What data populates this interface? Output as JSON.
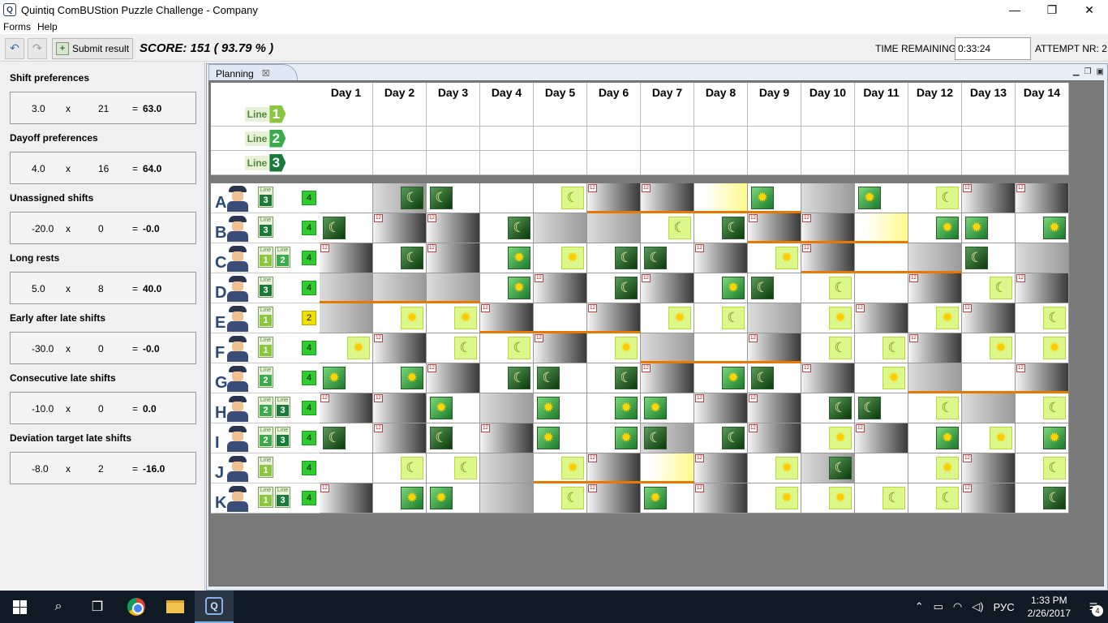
{
  "window": {
    "title": "Quintiq ComBUStion Puzzle Challenge - Company",
    "app_icon_glyph": "Q",
    "controls": [
      "—",
      "❐",
      "✕"
    ]
  },
  "menu": [
    "Forms",
    "Help"
  ],
  "toolbar": {
    "undo_icon": "↶",
    "redo_icon": "↷",
    "submit_label": "Submit result",
    "score_text": "SCORE: 151  ( 93.79 % )",
    "time_label": "TIME REMAINING",
    "time_value": "0:33:24",
    "attempt_text": "ATTEMPT NR:  2"
  },
  "score_sections": [
    {
      "title": "Shift preferences",
      "weight": "3.0",
      "x": "x",
      "count": "21",
      "eq": "=",
      "result": "63.0"
    },
    {
      "title": "Dayoff preferences",
      "weight": "4.0",
      "x": "x",
      "count": "16",
      "eq": "=",
      "result": "64.0"
    },
    {
      "title": "Unassigned shifts",
      "weight": "-20.0",
      "x": "x",
      "count": "0",
      "eq": "=",
      "result": "-0.0"
    },
    {
      "title": "Long rests",
      "weight": "5.0",
      "x": "x",
      "count": "8",
      "eq": "=",
      "result": "40.0"
    },
    {
      "title": "Early after late shifts",
      "weight": "-30.0",
      "x": "x",
      "count": "0",
      "eq": "=",
      "result": "-0.0"
    },
    {
      "title": "Consecutive late shifts",
      "weight": "-10.0",
      "x": "x",
      "count": "0",
      "eq": "=",
      "result": "0.0"
    },
    {
      "title": "Deviation target late shifts",
      "weight": "-8.0",
      "x": "x",
      "count": "2",
      "eq": "=",
      "result": "-16.0"
    }
  ],
  "planning": {
    "tab_label": "Planning",
    "tab_close": "☒",
    "days": [
      "Day 1",
      "Day 2",
      "Day 3",
      "Day 4",
      "Day 5",
      "Day 6",
      "Day 7",
      "Day 8",
      "Day 9",
      "Day 10",
      "Day 11",
      "Day 12",
      "Day 13",
      "Day 14"
    ],
    "lines": [
      {
        "word": "Line",
        "num": "1",
        "color": "#8cc63f"
      },
      {
        "word": "Line",
        "num": "2",
        "color": "#3aaa4a"
      },
      {
        "word": "Line",
        "num": "3",
        "color": "#1a7a3a"
      }
    ],
    "tag12": "12",
    "employees": [
      {
        "id": "A",
        "lines": [
          {
            "word": "Line",
            "num": "3"
          }
        ],
        "count": "4",
        "warn": false,
        "cells": [
          "EL",
          "RL",
          "L",
          "x",
          "PL",
          "T",
          "T",
          "P",
          "E",
          "R",
          "E",
          "PL",
          "T",
          "T"
        ],
        "ob": [
          5,
          6,
          7,
          8
        ]
      },
      {
        "id": "B",
        "lines": [
          {
            "word": "Line",
            "num": "3"
          }
        ],
        "count": "4",
        "warn": false,
        "cells": [
          "L",
          "T",
          "T",
          "L",
          "R",
          "R",
          "PL",
          "L",
          "T",
          "T",
          "P",
          "E",
          "E",
          "E"
        ],
        "ob": [
          8,
          9,
          10
        ]
      },
      {
        "id": "C",
        "lines": [
          {
            "word": "Line",
            "num": "1"
          },
          {
            "word": "Line",
            "num": "2"
          }
        ],
        "count": "4",
        "warn": false,
        "cells": [
          "T",
          "L",
          "T",
          "E",
          "PE",
          "L",
          "L",
          "T",
          "PE",
          "D",
          "x",
          "R",
          "L",
          "R"
        ],
        "ob": [
          9,
          10,
          11
        ]
      },
      {
        "id": "D",
        "lines": [
          {
            "word": "Line",
            "num": "3"
          }
        ],
        "count": "4",
        "warn": false,
        "cells": [
          "R",
          "R",
          "R",
          "E",
          "T",
          "L",
          "T",
          "E",
          "L",
          "PL",
          "x",
          "T",
          "PL",
          "T"
        ],
        "ob": [
          0,
          1,
          2
        ]
      },
      {
        "id": "E",
        "lines": [
          {
            "word": "Line",
            "num": "1"
          }
        ],
        "count": "2",
        "warn": true,
        "cells": [
          "R",
          "PE",
          "PE",
          "T",
          "x",
          "T",
          "PE",
          "PL",
          "R",
          "PE",
          "T",
          "PE",
          "T",
          "PL"
        ],
        "ob": [
          3,
          4,
          5
        ]
      },
      {
        "id": "F",
        "lines": [
          {
            "word": "Line",
            "num": "1"
          }
        ],
        "count": "4",
        "warn": false,
        "cells": [
          "PE",
          "T",
          "PL",
          "PL",
          "T",
          "PE",
          "R",
          "x",
          "T",
          "PL",
          "PL",
          "T",
          "PE",
          "PE"
        ],
        "ob": [
          6,
          7,
          8
        ]
      },
      {
        "id": "G",
        "lines": [
          {
            "word": "Line",
            "num": "2"
          }
        ],
        "count": "4",
        "warn": false,
        "cells": [
          "E",
          "E",
          "T",
          "L",
          "L",
          "L",
          "T",
          "E",
          "L",
          "T",
          "PE",
          "R",
          "x",
          "T"
        ],
        "ob": [
          11,
          12,
          13
        ]
      },
      {
        "id": "H",
        "lines": [
          {
            "word": "Line",
            "num": "2"
          },
          {
            "word": "Line",
            "num": "3"
          }
        ],
        "count": "4",
        "warn": false,
        "cells": [
          "T",
          "T",
          "E",
          "R",
          "E",
          "E",
          "E",
          "T",
          "T",
          "L",
          "L",
          "PL",
          "R",
          "PL"
        ],
        "ob": []
      },
      {
        "id": "I",
        "lines": [
          {
            "word": "Line",
            "num": "2"
          },
          {
            "word": "Line",
            "num": "3"
          }
        ],
        "count": "4",
        "warn": false,
        "cells": [
          "L",
          "T",
          "L",
          "T",
          "E",
          "E",
          "RL",
          "L",
          "T",
          "PE",
          "T",
          "E",
          "PE",
          "E"
        ],
        "ob": []
      },
      {
        "id": "J",
        "lines": [
          {
            "word": "Line",
            "num": "1"
          }
        ],
        "count": "4",
        "warn": false,
        "cells": [
          "x",
          "PL",
          "PL",
          "R",
          "PE",
          "T",
          "P",
          "T",
          "PE",
          "RL",
          "x",
          "PE",
          "T",
          "PL",
          "T"
        ],
        "ob": [
          4,
          5,
          6
        ]
      },
      {
        "id": "K",
        "lines": [
          {
            "word": "Line",
            "num": "1"
          },
          {
            "word": "Line",
            "num": "3"
          }
        ],
        "count": "4",
        "warn": false,
        "cells": [
          "T",
          "E",
          "E",
          "R",
          "PL",
          "T",
          "E",
          "T",
          "PE",
          "PE",
          "PL",
          "PL",
          "T",
          "L"
        ],
        "ob": []
      }
    ]
  },
  "taskbar": {
    "tray_lang": "РУС",
    "time": "1:33 PM",
    "date": "2/26/2017",
    "notif_count": "4"
  }
}
